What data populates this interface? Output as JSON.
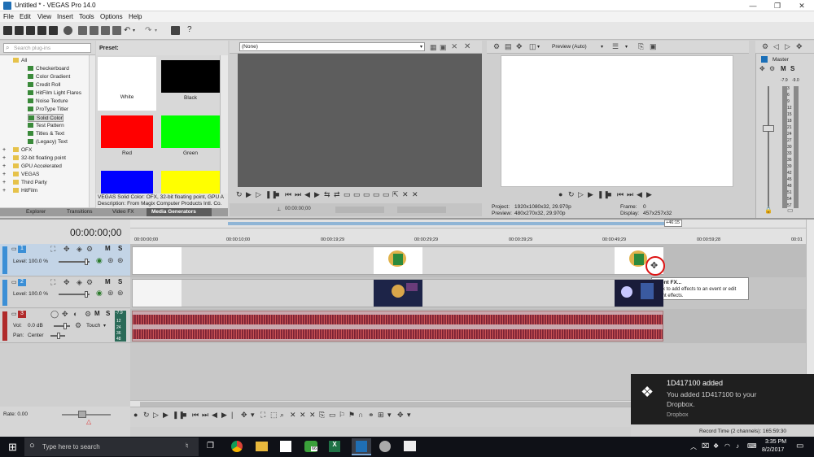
{
  "window": {
    "title": "Untitled * - VEGAS Pro 14.0"
  },
  "menu": [
    "File",
    "Edit",
    "View",
    "Insert",
    "Tools",
    "Options",
    "Help"
  ],
  "plugin_panel": {
    "search_placeholder": "Search plug-ins",
    "preset_label": "Preset:",
    "tree": [
      {
        "label": "All",
        "level": 0,
        "type": "folder"
      },
      {
        "label": "Checkerboard",
        "level": 1,
        "type": "fx"
      },
      {
        "label": "Color Gradient",
        "level": 1,
        "type": "fx"
      },
      {
        "label": "Credit Roll",
        "level": 1,
        "type": "fx"
      },
      {
        "label": "HitFilm Light Flares",
        "level": 1,
        "type": "fx"
      },
      {
        "label": "Noise Texture",
        "level": 1,
        "type": "fx"
      },
      {
        "label": "ProType Titler",
        "level": 1,
        "type": "fx"
      },
      {
        "label": "Solid Color",
        "level": 1,
        "type": "fx",
        "selected": true
      },
      {
        "label": "Test Pattern",
        "level": 1,
        "type": "fx"
      },
      {
        "label": "Titles & Text",
        "level": 1,
        "type": "fx"
      },
      {
        "label": "(Legacy) Text",
        "level": 1,
        "type": "fx"
      },
      {
        "label": "OFX",
        "level": 0,
        "type": "folder"
      },
      {
        "label": "32-bit floating point",
        "level": 0,
        "type": "folder"
      },
      {
        "label": "GPU Accelerated",
        "level": 0,
        "type": "folder"
      },
      {
        "label": "VEGAS",
        "level": 0,
        "type": "folder"
      },
      {
        "label": "Third Party",
        "level": 0,
        "type": "folder"
      },
      {
        "label": "HitFilm",
        "level": 0,
        "type": "folder"
      }
    ],
    "presets": [
      {
        "label": "White",
        "color": "#ffffff"
      },
      {
        "label": "Black",
        "color": "#000000"
      },
      {
        "label": "Red",
        "color": "#ff0000"
      },
      {
        "label": "Green",
        "color": "#00ff00"
      },
      {
        "label": "",
        "color": "#0000ff"
      },
      {
        "label": "",
        "color": "#ffff00"
      }
    ],
    "info_line1": "VEGAS Solid Color: OFX, 32-bit floating point, GPU A",
    "info_line2": "Description: From Magix Computer Products Intl. Co.",
    "tabs": [
      "Explorer",
      "Transitions",
      "Video FX",
      "Media Generators"
    ]
  },
  "trimmer": {
    "dropdown_value": "(None)",
    "timecode": "00:00:00;00"
  },
  "preview": {
    "mode": "Preview (Auto)",
    "project_label": "Project:",
    "project_value": "1920x1080x32, 29.970p",
    "preview_label": "Preview:",
    "preview_value": "480x270x32, 29.970p",
    "frame_label": "Frame:",
    "frame_value": "0",
    "display_label": "Display:",
    "display_value": "457x257x32"
  },
  "master": {
    "label": "Master",
    "db_left": "-7.9",
    "db_right": "-9.0",
    "scale": [
      "3",
      "6",
      "9",
      "12",
      "15",
      "18",
      "21",
      "24",
      "27",
      "30",
      "33",
      "36",
      "39",
      "42",
      "45",
      "48",
      "51",
      "54",
      "57"
    ]
  },
  "timeline": {
    "timecode": "00:00:00;00",
    "region_end": "+46:15",
    "ruler": [
      "00:00:00;00",
      "00:00:10;00",
      "00:00:19;29",
      "00:00:29;29",
      "00:00:39;29",
      "00:00:49;29",
      "00:00:59;28",
      "00:01"
    ],
    "tracks": [
      {
        "number": "1",
        "level_label": "Level: 100.0 %",
        "color": "#3b8fd6"
      },
      {
        "number": "2",
        "level_label": "Level: 100.0 %",
        "color": "#3b8fd6"
      },
      {
        "number": "3",
        "vol_label": "Vol:",
        "vol_value": "0.0 dB",
        "pan_label": "Pan:",
        "pan_value": "Center",
        "touch": "Touch",
        "meter": [
          "-7.9",
          "12",
          "24",
          "36",
          "48"
        ],
        "color": "#b02a2a"
      }
    ],
    "tooltip_title": "Event FX...",
    "tooltip_text_1": "Click to add effects to an event or edit",
    "tooltip_text_2": "event effects.",
    "rate_label": "Rate: 0.00",
    "record_time": "Record Time (2 channels): 165:59:30"
  },
  "toast": {
    "title": "1D417100 added",
    "line1": "You added 1D417100 to your",
    "line2": "Dropbox.",
    "source": "Dropbox"
  },
  "taskbar": {
    "search_placeholder": "Type here to search",
    "badge": "66",
    "time": "3:35 PM",
    "date": "8/2/2017"
  }
}
